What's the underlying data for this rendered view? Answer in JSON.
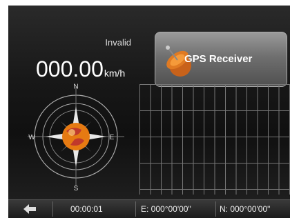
{
  "status": {
    "text": "Invalid"
  },
  "speed": {
    "value": "000.00",
    "unit": "km/h"
  },
  "gps_button": {
    "label": "GPS Receiver"
  },
  "compass": {
    "north": "N",
    "south": "S",
    "east": "E",
    "west": "W"
  },
  "bottom_bar": {
    "time": "00:00:01",
    "east": "E: 000°00'00\"",
    "north": "N: 000°00'00\""
  }
}
